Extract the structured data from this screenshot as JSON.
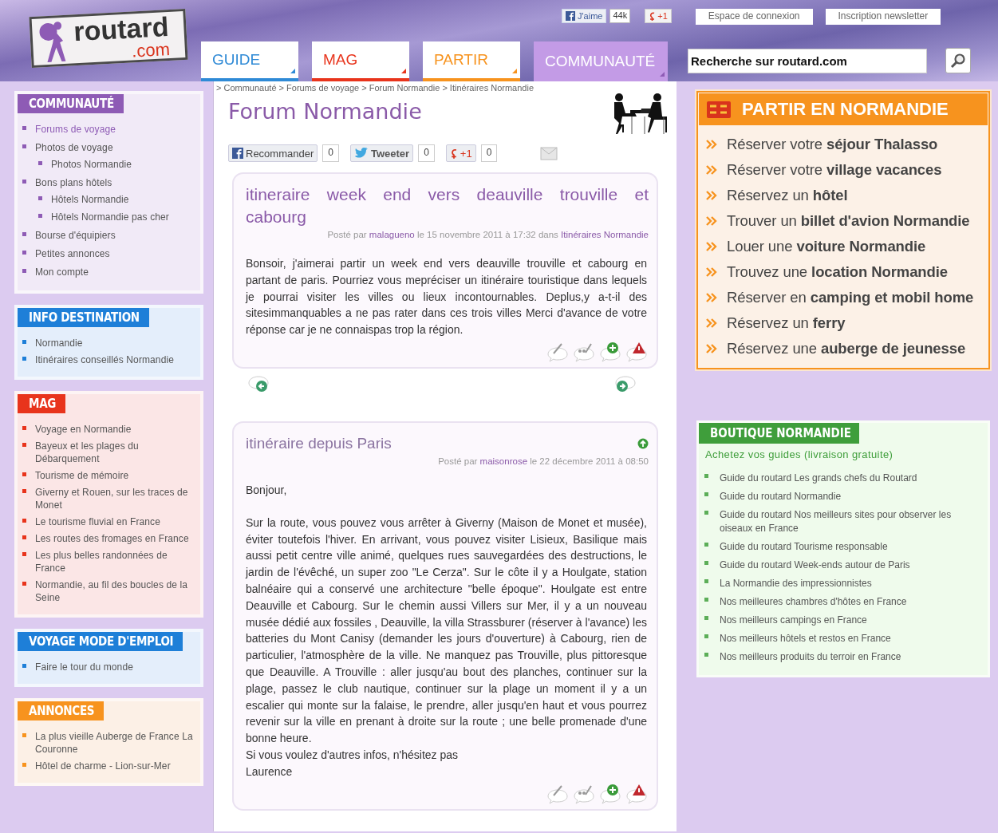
{
  "header": {
    "logo": {
      "name": "routard",
      "suffix": ".com"
    },
    "social": {
      "like": "J'aime",
      "like_count": "44k",
      "plus": "+1"
    },
    "links": [
      "Espace de connexion",
      "Inscription newsletter"
    ],
    "tabs": [
      {
        "label": "GUIDE",
        "selected": false,
        "color": "#2f8ad6"
      },
      {
        "label": "MAG",
        "selected": false,
        "color": "#e8341c"
      },
      {
        "label": "PARTIR",
        "selected": false,
        "color": "#f7931e"
      },
      {
        "label": "COMMUNAUTÉ",
        "selected": true,
        "color": "#c39be6"
      }
    ],
    "search": {
      "value": "Recherche sur routard.com"
    }
  },
  "sidebar": [
    {
      "title": "COMMUNAUTÉ",
      "color": "#8e5bb5",
      "items": [
        {
          "label": "Forums de voyage",
          "selected": true
        },
        {
          "label": "Photos de voyage",
          "selected": false,
          "children": [
            {
              "label": "Photos Normandie",
              "selected": false
            }
          ]
        },
        {
          "label": "Bons plans hôtels",
          "selected": false,
          "children": [
            {
              "label": "Hôtels Normandie",
              "selected": false
            },
            {
              "label": "Hôtels Normandie pas cher",
              "selected": false
            }
          ]
        },
        {
          "label": "Bourse d'équipiers",
          "selected": false
        },
        {
          "label": "Petites annonces",
          "selected": false
        },
        {
          "label": "Mon compte",
          "selected": false
        }
      ]
    },
    {
      "title": "INFO DESTINATION",
      "color": "#1e7fd8",
      "items": [
        {
          "label": "Normandie"
        },
        {
          "label": "Itinéraires conseillés Normandie"
        }
      ]
    },
    {
      "title": "MAG",
      "color": "#e8341c",
      "items": [
        {
          "label": "Voyage en Normandie"
        },
        {
          "label": "Bayeux et les plages du Débarquement"
        },
        {
          "label": "Tourisme de mémoire"
        },
        {
          "label": "Giverny et Rouen, sur les traces de Monet"
        },
        {
          "label": "Le tourisme fluvial en France"
        },
        {
          "label": "Les routes des fromages en France"
        },
        {
          "label": "Les plus belles randonnées de France"
        },
        {
          "label": "Normandie, au fil des boucles de la Seine"
        }
      ]
    },
    {
      "title": "VOYAGE MODE D'EMPLOI",
      "color": "#1e7fd8",
      "items": [
        {
          "label": "Faire le tour du monde"
        }
      ]
    },
    {
      "title": "ANNONCES",
      "color": "#f7931e",
      "items": [
        {
          "label": "La plus vieille Auberge de France La Couronne"
        },
        {
          "label": "Hôtel de charme - Lion-sur-Mer"
        }
      ]
    }
  ],
  "forum": {
    "breadcrumb": "> Communauté > Forums de voyage > Forum Normandie > Itinéraires Normandie",
    "title": "Forum Normandie",
    "share": [
      {
        "kind": "facebook",
        "label": "Recommander",
        "count": "0"
      },
      {
        "kind": "twitter",
        "label": "Tweeter",
        "count": "0"
      },
      {
        "kind": "gplus",
        "label": "+1",
        "count": "0"
      },
      {
        "kind": "email"
      }
    ],
    "posts": [
      {
        "kind": "topic",
        "title": "itineraire week end vers deauville trouville et cabourg",
        "posted_by": "Posté par",
        "author": "malagueno",
        "date": "le 15 novembre 2011 à 17:32 dans",
        "category": "Itinéraires Normandie",
        "body": [
          "Bonsoir, j'aimerai partir un week end vers deauville trouville et cabourg en partant de paris. Pourriez vous mepréciser un itinéraire touristique dans lequels je pourrai visiter les villes ou lieux incontournables. Deplus,y a-t-il des sitesimmanquables a ne pas rater dans ces trois villes Merci d'avance de votre réponse car je ne connaispas trop la région."
        ]
      },
      {
        "kind": "reply",
        "title": "itinéraire depuis Paris",
        "posted_by": "Posté par",
        "author": "maisonrose",
        "date": "le 22 décembre 2011 à 08:50",
        "body": [
          "Bonjour,",
          "Sur la route, vous pouvez vous arrêter à Giverny (Maison de Monet et musée), éviter toutefois l'hiver. En arrivant, vous pouvez visiter Lisieux, Basilique mais aussi petit centre ville animé, quelques rues sauvegardées des destructions, le jardin de l'évêché, un super zoo \"Le Cerza\". Sur le côte il y a Houlgate, station balnéaire qui a conservé une architecture \"belle époque\". Houlgate est entre Deauville et Cabourg. Sur le chemin aussi Villers sur Mer, il y a un nouveau musée dédié aux fossiles , Deauville, la villa Strassburer (réserver à l'avance) les batteries du Mont Canisy (demander les jours d'ouverture) à Cabourg, rien de particulier, l'atmosphère de la ville. Ne manquez pas Trouville, plus pittoresque que Deauville. A Trouville : aller jusqu'au bout des planches, continuer sur la plage, passez le club nautique, continuer sur la plage un moment il y a un escalier qui monte sur la falaise, le prendre, aller jusqu'en haut et vous pourrez revenir sur la ville en prenant à droite sur la route ; une belle promenade d'une bonne heure.\nSi vous voulez d'autres infos, n'hésitez pas\nLaurence"
        ]
      }
    ]
  },
  "partir": {
    "title": "PARTIR EN NORMANDIE",
    "items": [
      "Réserver votre **séjour Thalasso**",
      "Réserver votre **village vacances**",
      "Réservez un **hôtel**",
      "Trouver un **billet d'avion Normandie**",
      "Louer une **voiture Normandie**",
      "Trouvez une **location Normandie**",
      "Réserver en **camping et mobil home**",
      "Réservez un **ferry**",
      "Réservez une **auberge de jeunesse**"
    ]
  },
  "boutique": {
    "title": "BOUTIQUE NORMANDIE",
    "subtitle": "Achetez vos guides (livraison gratuite)",
    "items": [
      "Guide du routard Les grands chefs du Routard",
      "Guide du routard Normandie",
      "Guide du routard Nos meilleurs sites pour observer les oiseaux en France",
      "Guide du routard Tourisme responsable",
      "Guide du routard Week-ends autour de Paris",
      "La Normandie des impressionnistes",
      "Nos meilleures chambres d'hôtes en France",
      "Nos meilleurs campings en France",
      "Nos meilleurs hôtels et restos en France",
      "Nos meilleurs produits du terroir en France"
    ]
  }
}
